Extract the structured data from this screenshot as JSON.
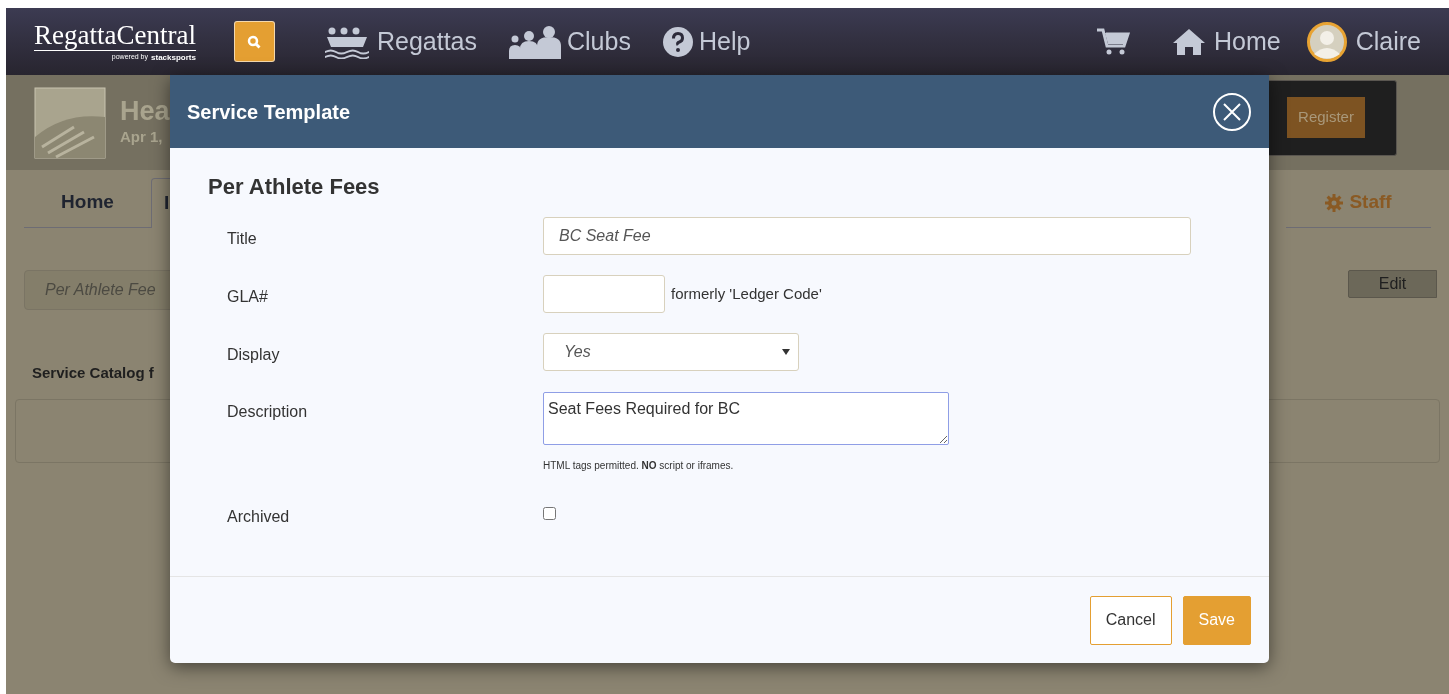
{
  "nav": {
    "logo": "RegattaCentral",
    "tagline": "powered by",
    "brand": "stacksports",
    "items": [
      {
        "kind": "regattas",
        "label": "Regattas"
      },
      {
        "kind": "clubs",
        "label": "Clubs"
      },
      {
        "kind": "help",
        "label": "Help"
      }
    ],
    "home": "Home",
    "user": "Claire"
  },
  "event": {
    "title": "Hea",
    "date": "Apr 1,",
    "register": "Register"
  },
  "tabs": [
    {
      "label": "Home",
      "selected": false
    },
    {
      "label": "I",
      "selected": true
    },
    {
      "label": "Staff",
      "selected": false
    }
  ],
  "filter_field": {
    "placeholder": "Per Athlete Fee"
  },
  "edit_button": "Edit",
  "section_title": "Service Catalog f",
  "modal": {
    "title": "Service Template",
    "heading": "Per Athlete Fees",
    "fields": [
      {
        "kind": "text",
        "label": "Title",
        "value": "BC Seat Fee"
      },
      {
        "kind": "short",
        "label": "GLA#",
        "hint": "formerly 'Ledger Code'"
      },
      {
        "kind": "select",
        "label": "Display",
        "value": "Yes"
      },
      {
        "kind": "textarea",
        "label": "Description",
        "value": "Seat Fees Required for BC",
        "note": "HTML tags permitted. **NO** script or iframes."
      },
      {
        "kind": "checkbox",
        "label": "Archived",
        "checked": false
      }
    ],
    "buttons": [
      {
        "kind": "cancel",
        "label": "Cancel"
      },
      {
        "kind": "save",
        "label": "Save"
      }
    ]
  }
}
